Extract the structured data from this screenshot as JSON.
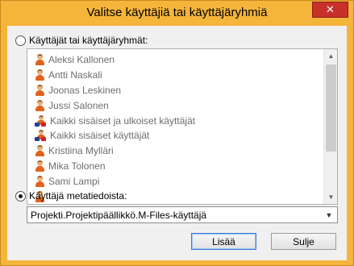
{
  "window": {
    "title": "Valitse käyttäjiä tai käyttäjäryhmiä",
    "close_glyph": "✕"
  },
  "option_users": {
    "label": "Käyttäjät tai käyttäjäryhmät:",
    "checked": false
  },
  "user_list": {
    "items": [
      {
        "label": "Aleksi Kallonen",
        "icon": "user-icon"
      },
      {
        "label": "Antti Naskali",
        "icon": "user-icon"
      },
      {
        "label": "Joonas Leskinen",
        "icon": "user-icon"
      },
      {
        "label": "Jussi Salonen",
        "icon": "user-icon"
      },
      {
        "label": "Kaikki sisäiset ja ulkoiset käyttäjät",
        "icon": "user-group-icon"
      },
      {
        "label": "Kaikki sisäiset käyttäjät",
        "icon": "user-group-icon"
      },
      {
        "label": "Kristiina Mylläri",
        "icon": "user-icon"
      },
      {
        "label": "Mika Tolonen",
        "icon": "user-icon"
      },
      {
        "label": "Sami Lampi",
        "icon": "user-icon"
      },
      {
        "label": "",
        "icon": "user-icon"
      }
    ],
    "scroll_up_glyph": "▲",
    "scroll_down_glyph": "▼"
  },
  "option_metadata": {
    "label": "Käyttäjä metatiedoista:",
    "checked": true
  },
  "metadata_select": {
    "value": "Projekti.Projektipäällikkö.M-Files-käyttäjä",
    "arrow_glyph": "▼"
  },
  "buttons": {
    "add": "Lisää",
    "close": "Sulje"
  }
}
